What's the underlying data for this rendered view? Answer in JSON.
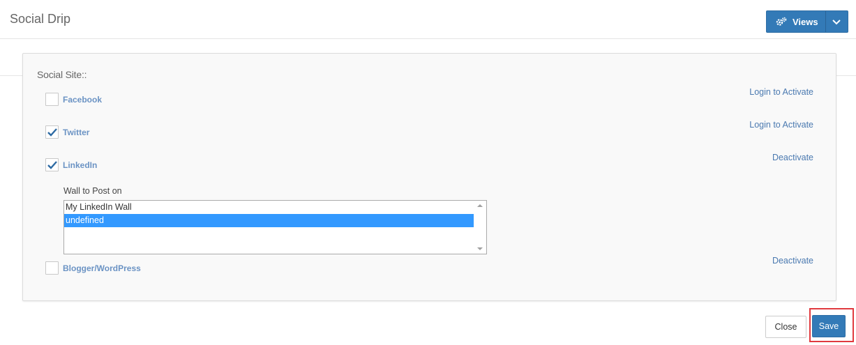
{
  "header": {
    "title": "Social Drip",
    "views_label": "Views",
    "views_icon": "gears-icon",
    "views_caret_icon": "chevron-down-icon"
  },
  "colors": {
    "primary": "#337ab7",
    "link": "#4a79b0",
    "site_name": "#6b93c4",
    "highlight": "#e0393e",
    "list_selection": "#3399ff"
  },
  "panel": {
    "section_label": "Social Site::",
    "sites": [
      {
        "name": "Facebook",
        "checked": false,
        "action": "Login to Activate"
      },
      {
        "name": "Twitter",
        "checked": true,
        "action": "Login to Activate"
      },
      {
        "name": "LinkedIn",
        "checked": true,
        "action": "Deactivate"
      },
      {
        "name": "Blogger/WordPress",
        "checked": false,
        "action": "Deactivate"
      }
    ],
    "wall": {
      "label": "Wall to Post on",
      "options": [
        "My LinkedIn Wall",
        "undefined"
      ],
      "selected_index": 1
    }
  },
  "footer": {
    "close_label": "Close",
    "save_label": "Save"
  }
}
